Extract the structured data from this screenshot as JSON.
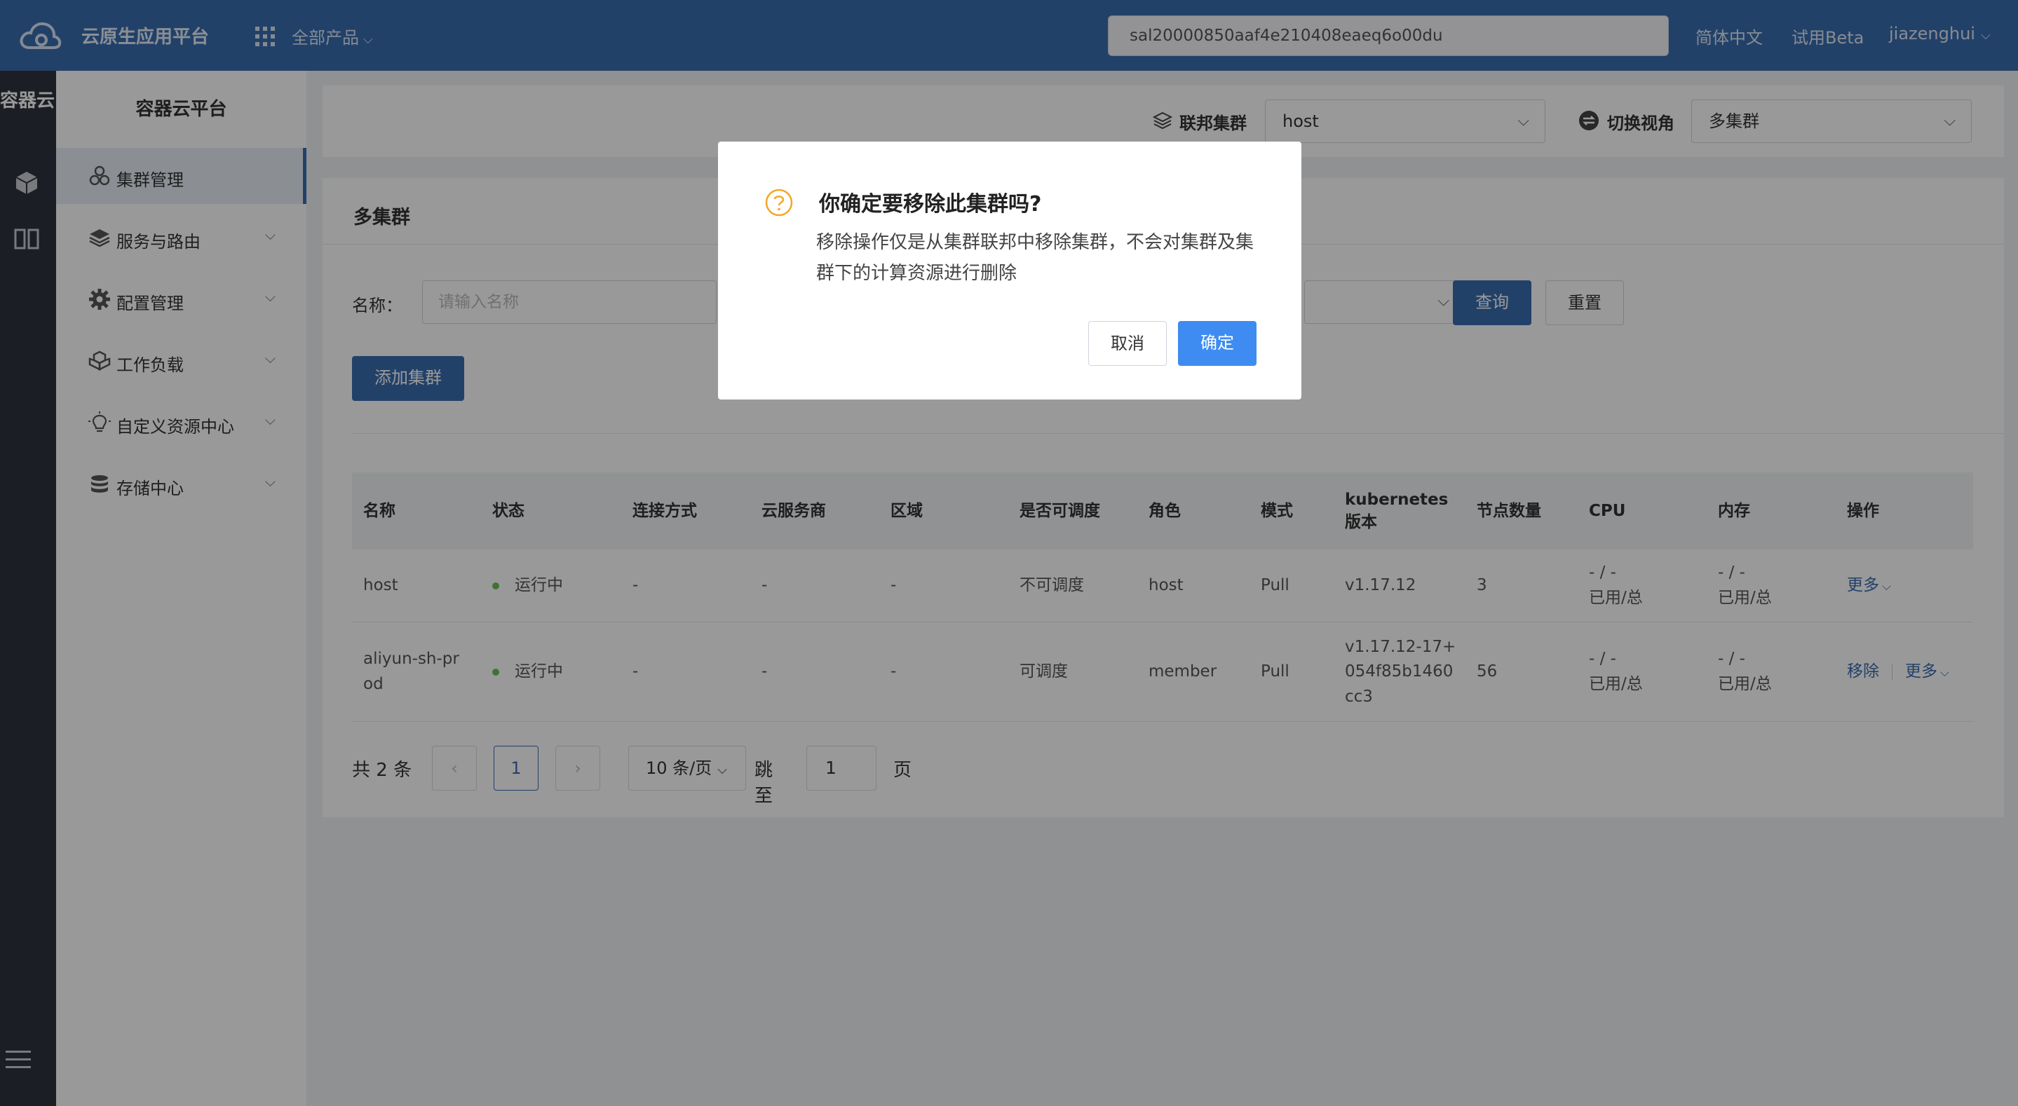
{
  "topbar": {
    "app_title": "云原生应用平台",
    "all_products": "全部产品",
    "search_value": "sal20000850aaf4e210408eaeq6o00du",
    "lang": "简体中文",
    "beta": "试用Beta",
    "user": "jiazenghui"
  },
  "rail": {
    "title": "容器云"
  },
  "sidebar": {
    "title": "容器云平台",
    "items": [
      {
        "label": "集群管理",
        "icon": "cluster-icon"
      },
      {
        "label": "服务与路由",
        "icon": "layers-icon"
      },
      {
        "label": "配置管理",
        "icon": "gear-icon"
      },
      {
        "label": "工作负载",
        "icon": "workload-icon"
      },
      {
        "label": "自定义资源中心",
        "icon": "lightbulb-icon"
      },
      {
        "label": "存储中心",
        "icon": "database-icon"
      }
    ]
  },
  "content_top": {
    "federation_label": "联邦集群",
    "federation_value": "host",
    "view_label": "切换视角",
    "view_value": "多集群"
  },
  "panel": {
    "title": "多集群",
    "name_label": "名称：",
    "name_placeholder": "请输入名称",
    "query": "查询",
    "reset": "重置",
    "add_cluster": "添加集群"
  },
  "table": {
    "headers": [
      "名称",
      "状态",
      "连接方式",
      "云服务商",
      "区域",
      "是否可调度",
      "角色",
      "模式",
      "kubernetes\n版本",
      "节点数量",
      "CPU",
      "内存",
      "操作"
    ],
    "rows": [
      {
        "name": "host",
        "status": "运行中",
        "connection": "-",
        "provider": "-",
        "region": "-",
        "schedulable": "不可调度",
        "role": "host",
        "mode": "Pull",
        "version": "v1.17.12",
        "nodes": "3",
        "cpu": "- / -\n已用/总",
        "memory": "- / -\n已用/总",
        "action_more": "更多"
      },
      {
        "name": "aliyun-sh-prod",
        "status": "运行中",
        "connection": "-",
        "provider": "-",
        "region": "-",
        "schedulable": "可调度",
        "role": "member",
        "mode": "Pull",
        "version": "v1.17.12-17+054f85b1460cc3",
        "nodes": "56",
        "cpu": "- / -\n已用/总",
        "memory": "- / -\n已用/总",
        "action_remove": "移除",
        "action_more": "更多"
      }
    ]
  },
  "pager": {
    "total": "共 2 条",
    "prev": "‹",
    "page": "1",
    "next": "›",
    "size": "10 条/页",
    "goto": "跳至",
    "goto_value": "1",
    "page_unit": "页"
  },
  "modal": {
    "title": "你确定要移除此集群吗?",
    "body": "移除操作仅是从集群联邦中移除集群，不会对集群及集群下的计算资源进行删除",
    "cancel": "取消",
    "ok": "确定"
  },
  "colors": {
    "topbar": "#3a6db0",
    "rail": "#2d333c",
    "primary": "#3a6db0",
    "modal_ok": "#3e8cf2",
    "status_running": "#6bbf59",
    "warning_icon": "#f5a623"
  }
}
